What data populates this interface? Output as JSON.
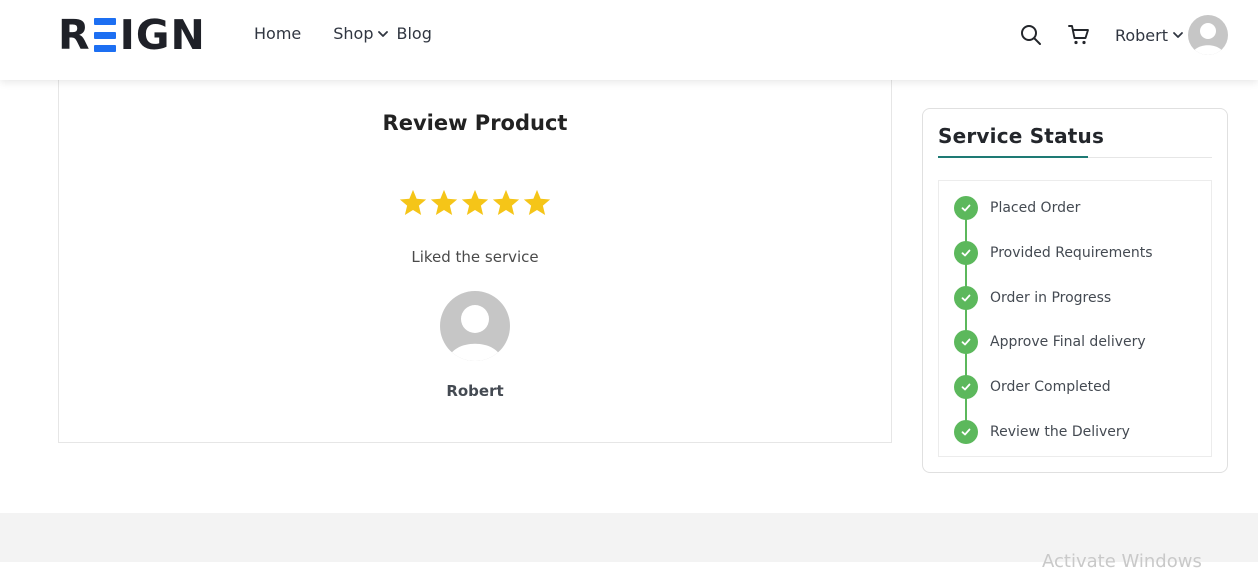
{
  "header": {
    "logo": {
      "left": "R",
      "right": "IGN",
      "accent_color": "#1d6ff2"
    },
    "nav": [
      {
        "label": "Home"
      },
      {
        "label": "Shop"
      },
      {
        "label": "Blog"
      }
    ],
    "user": {
      "name": "Robert"
    },
    "icons": [
      "search-icon",
      "cart-icon",
      "chevron-down-icon",
      "user-avatar"
    ]
  },
  "review": {
    "title": "Review Product",
    "rating": 5,
    "rating_max": 5,
    "comment": "Liked the service",
    "reviewer": "Robert",
    "star_color": "#f5c518"
  },
  "service_status": {
    "title": "Service Status",
    "accent_color": "#5cb85c",
    "steps": [
      {
        "label": "Placed Order"
      },
      {
        "label": "Provided Requirements"
      },
      {
        "label": "Order in Progress"
      },
      {
        "label": "Approve Final delivery"
      },
      {
        "label": "Order Completed"
      },
      {
        "label": "Review the Delivery"
      }
    ]
  },
  "footer": {
    "watermark": "Activate Windows"
  }
}
